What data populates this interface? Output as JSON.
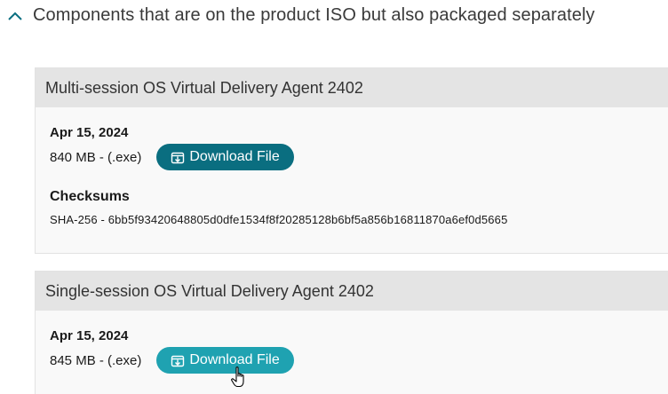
{
  "section": {
    "title": "Components that are on the product ISO but also packaged separately",
    "expanded": true,
    "chevron_icon": "chevron-up-icon"
  },
  "downloads": [
    {
      "title": "Multi-session OS Virtual Delivery Agent 2402",
      "date": "Apr 15, 2024",
      "size": "840 MB - (.exe)",
      "button_label": "Download File",
      "button_icon": "download-box-icon",
      "button_color": "#0a6e80",
      "checksums_label": "Checksums",
      "checksum": "SHA-256 - 6bb5f93420648805d0dfe1534f8f20285128b6bf5a856b16811870a6ef0d5665"
    },
    {
      "title": "Single-session OS Virtual Delivery Agent 2402",
      "date": "Apr 15, 2024",
      "size": "845 MB - (.exe)",
      "button_label": "Download File",
      "button_icon": "download-box-icon",
      "button_color": "#1fa2b1",
      "button_state": "hover"
    }
  ],
  "colors": {
    "button_primary": "#0a6e80",
    "button_hover": "#1fa2b1",
    "card_header_bg": "#e4e4e4"
  }
}
